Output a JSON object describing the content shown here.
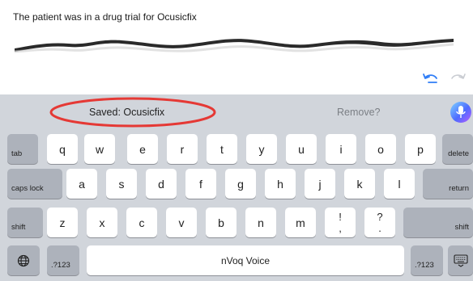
{
  "document": {
    "text": "The patient was in a drug trial for Ocusicfix"
  },
  "toolbar": {
    "undo_icon": "undo-icon",
    "redo_icon": "redo-icon"
  },
  "predictive_bar": {
    "saved_text": "Saved: Ocusicfix",
    "remove_text": "Remove?",
    "mic_icon": "microphone-icon",
    "highlight_color": "#e53935"
  },
  "keyboard": {
    "row1": [
      "tab",
      "q",
      "w",
      "e",
      "r",
      "t",
      "y",
      "u",
      "i",
      "o",
      "p",
      "delete"
    ],
    "row2": [
      "caps lock",
      "a",
      "s",
      "d",
      "f",
      "g",
      "h",
      "j",
      "k",
      "l",
      "return"
    ],
    "row3": [
      "shift",
      "z",
      "x",
      "c",
      "v",
      "b",
      "n",
      "m",
      "!",
      ",",
      "?",
      ".",
      "shift"
    ],
    "row4": [
      "globe-icon",
      ".?123",
      "nVoq Voice",
      ".?123",
      "keyboard-dismiss-icon"
    ]
  },
  "colors": {
    "keyboard_bg": "#d1d5db",
    "key_bg": "#ffffff",
    "fn_key_bg": "#adb2bb",
    "undo_accent": "#2f7df6"
  }
}
